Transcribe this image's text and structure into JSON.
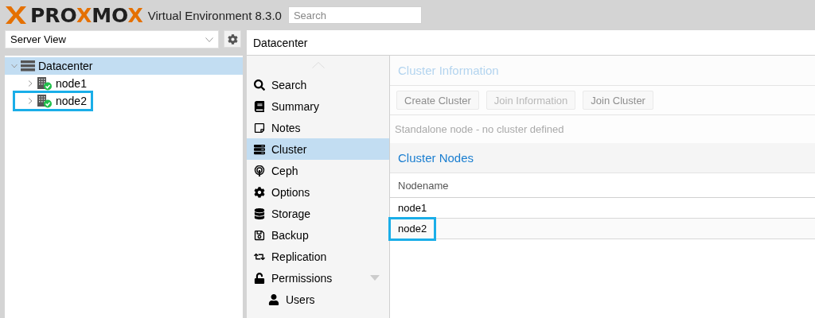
{
  "header": {
    "logo": [
      {
        "text": "PRO",
        "accent": false
      },
      {
        "text": "X",
        "accent": true
      },
      {
        "text": "MO",
        "accent": false
      },
      {
        "text": "X",
        "accent": true
      }
    ],
    "product": "Virtual Environment 8.3.0",
    "search": {
      "placeholder": "Search"
    }
  },
  "view_selector": {
    "value": "Server View"
  },
  "tree": [
    {
      "label": "Datacenter",
      "selected": true,
      "expanded": true,
      "highlighted": false,
      "children": [
        {
          "label": "node1",
          "selected": false,
          "expanded": false,
          "online": true,
          "highlighted": false
        },
        {
          "label": "node2",
          "selected": false,
          "expanded": false,
          "online": true,
          "highlighted": true
        }
      ]
    }
  ],
  "main": {
    "title": "Datacenter"
  },
  "nav": [
    {
      "label": "Search",
      "selected": false
    },
    {
      "label": "Summary",
      "selected": false
    },
    {
      "label": "Notes",
      "selected": false
    },
    {
      "label": "Cluster",
      "selected": true
    },
    {
      "label": "Ceph",
      "selected": false
    },
    {
      "label": "Options",
      "selected": false
    },
    {
      "label": "Storage",
      "selected": false
    },
    {
      "label": "Backup",
      "selected": false
    },
    {
      "label": "Replication",
      "selected": false
    },
    {
      "label": "Permissions",
      "selected": false,
      "expanded": true,
      "children": [
        {
          "label": "Users",
          "selected": false
        }
      ]
    }
  ],
  "cluster_information": {
    "title": "Cluster Information",
    "disabled": true,
    "buttons": [
      {
        "label": "Create Cluster",
        "disabled": false
      },
      {
        "label": "Join Information",
        "disabled": true
      },
      {
        "label": "Join Cluster",
        "disabled": false
      }
    ],
    "message": "Standalone node - no cluster defined"
  },
  "cluster_nodes": {
    "title": "Cluster Nodes",
    "columns": [
      "Nodename"
    ],
    "rows": [
      {
        "cells": [
          "node1"
        ],
        "highlighted": false
      },
      {
        "cells": [
          "node2"
        ],
        "highlighted": true
      }
    ]
  }
}
